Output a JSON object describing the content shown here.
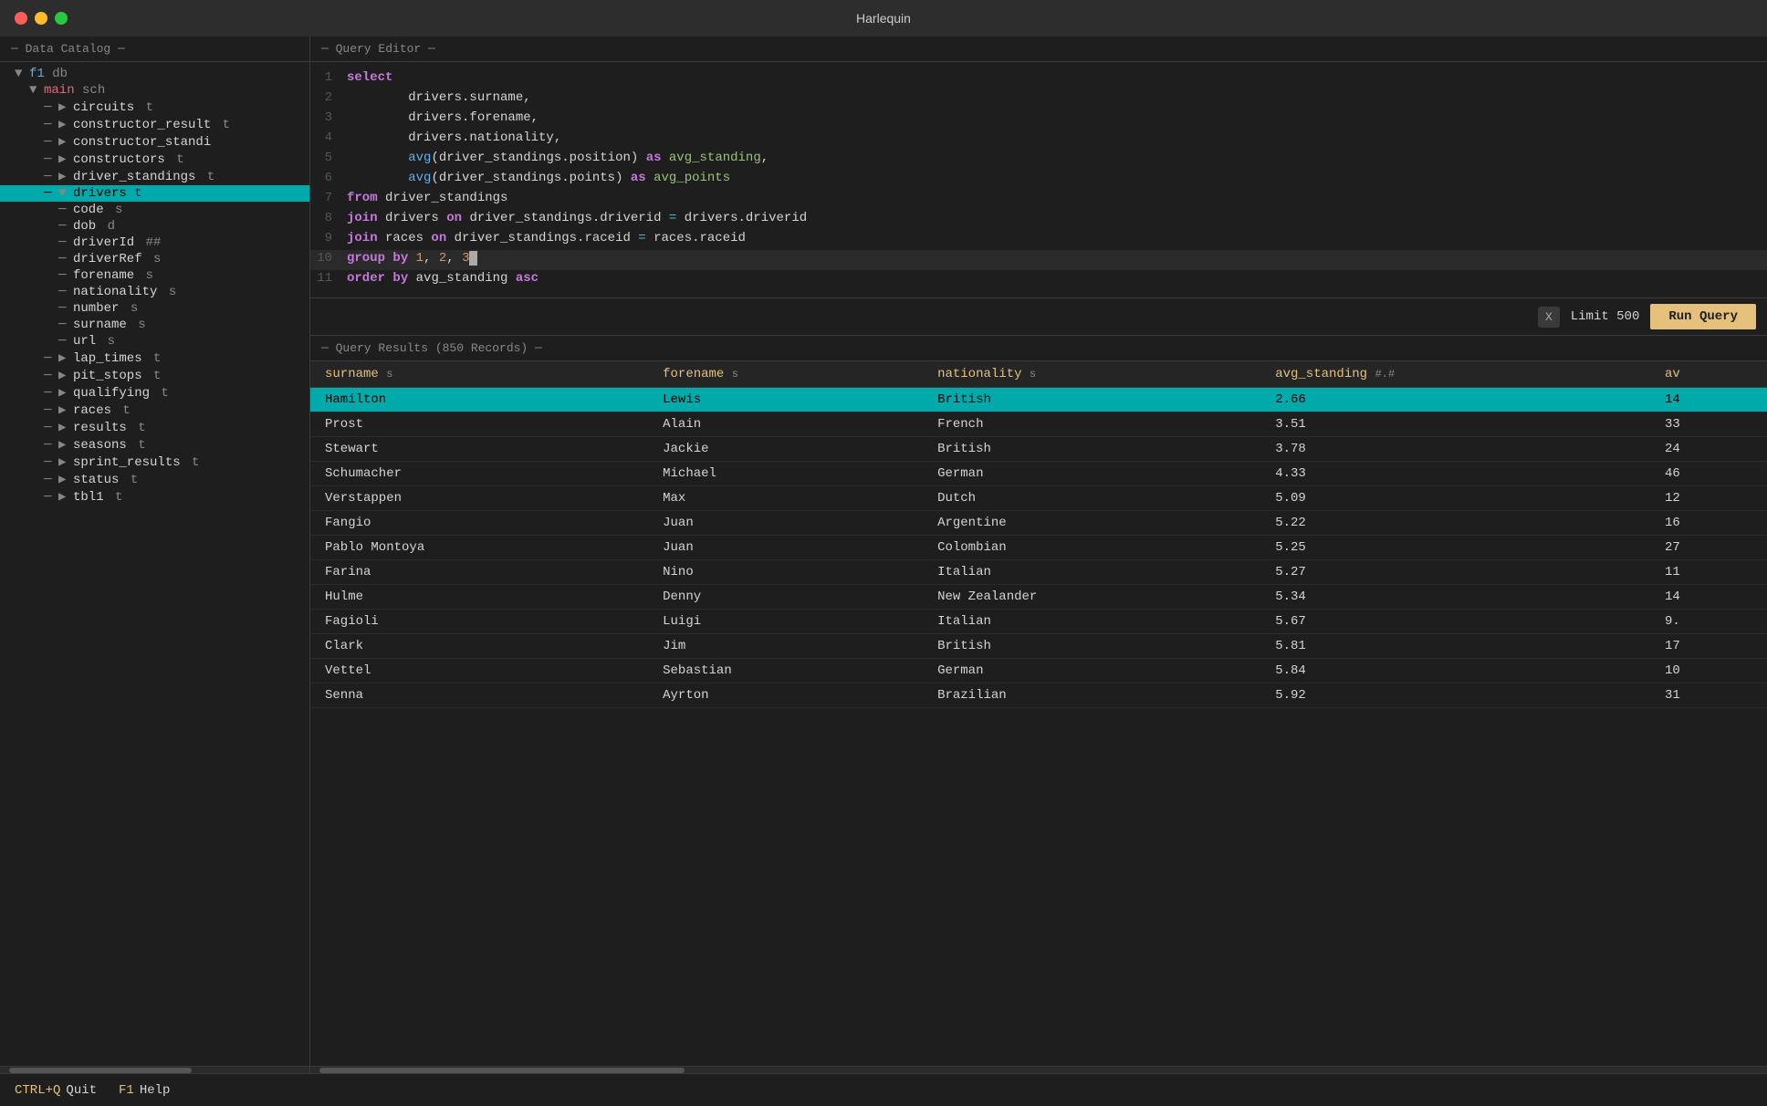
{
  "app": {
    "title": "Harlequin"
  },
  "titlebar": {
    "close": "close",
    "minimize": "minimize",
    "maximize": "maximize"
  },
  "dataCatalog": {
    "header": "─ Data Catalog ─",
    "tree": [
      {
        "label": "f1 db",
        "level": 0,
        "type": "db",
        "arrow": "▼",
        "icon": ""
      },
      {
        "label": "main",
        "suffix": " sch",
        "level": 1,
        "type": "schema",
        "arrow": "▼",
        "icon": ""
      },
      {
        "label": "circuits",
        "suffix": " t",
        "level": 2,
        "type": "table",
        "arrow": "▶",
        "icon": ""
      },
      {
        "label": "constructor_result",
        "suffix": " t",
        "level": 2,
        "type": "table",
        "arrow": "▶",
        "icon": ""
      },
      {
        "label": "constructor_standi",
        "suffix": "",
        "level": 2,
        "type": "table",
        "arrow": "▶",
        "icon": ""
      },
      {
        "label": "constructors",
        "suffix": " t",
        "level": 2,
        "type": "table",
        "arrow": "▶",
        "icon": ""
      },
      {
        "label": "driver_standings",
        "suffix": " t",
        "level": 2,
        "type": "table",
        "arrow": "▶",
        "icon": ""
      },
      {
        "label": "drivers",
        "suffix": " t",
        "level": 2,
        "type": "table",
        "arrow": "▼",
        "icon": "",
        "highlighted": true
      },
      {
        "label": "code",
        "suffix": " s",
        "level": 3,
        "type": "col",
        "arrow": "",
        "icon": "─"
      },
      {
        "label": "dob",
        "suffix": " d",
        "level": 3,
        "type": "col",
        "arrow": "",
        "icon": "─"
      },
      {
        "label": "driverId",
        "suffix": " ##",
        "level": 3,
        "type": "col",
        "arrow": "",
        "icon": "─"
      },
      {
        "label": "driverRef",
        "suffix": " s",
        "level": 3,
        "type": "col",
        "arrow": "",
        "icon": "─"
      },
      {
        "label": "forename",
        "suffix": " s",
        "level": 3,
        "type": "col",
        "arrow": "",
        "icon": "─"
      },
      {
        "label": "nationality",
        "suffix": " s",
        "level": 3,
        "type": "col",
        "arrow": "",
        "icon": "─"
      },
      {
        "label": "number",
        "suffix": " s",
        "level": 3,
        "type": "col",
        "arrow": "",
        "icon": "─"
      },
      {
        "label": "surname",
        "suffix": " s",
        "level": 3,
        "type": "col",
        "arrow": "",
        "icon": "─"
      },
      {
        "label": "url",
        "suffix": " s",
        "level": 3,
        "type": "col",
        "arrow": "",
        "icon": "─"
      },
      {
        "label": "lap_times",
        "suffix": " t",
        "level": 2,
        "type": "table",
        "arrow": "▶",
        "icon": ""
      },
      {
        "label": "pit_stops",
        "suffix": " t",
        "level": 2,
        "type": "table",
        "arrow": "▶",
        "icon": ""
      },
      {
        "label": "qualifying",
        "suffix": " t",
        "level": 2,
        "type": "table",
        "arrow": "▶",
        "icon": ""
      },
      {
        "label": "races",
        "suffix": " t",
        "level": 2,
        "type": "table",
        "arrow": "▶",
        "icon": ""
      },
      {
        "label": "results",
        "suffix": " t",
        "level": 2,
        "type": "table",
        "arrow": "▶",
        "icon": ""
      },
      {
        "label": "seasons",
        "suffix": " t",
        "level": 2,
        "type": "table",
        "arrow": "▶",
        "icon": ""
      },
      {
        "label": "sprint_results",
        "suffix": " t",
        "level": 2,
        "type": "table",
        "arrow": "▶",
        "icon": ""
      },
      {
        "label": "status",
        "suffix": " t",
        "level": 2,
        "type": "table",
        "arrow": "▶",
        "icon": ""
      },
      {
        "label": "tbl1",
        "suffix": " t",
        "level": 2,
        "type": "table",
        "arrow": "▶",
        "icon": ""
      }
    ]
  },
  "queryEditor": {
    "header": "─ Query Editor ─",
    "lines": [
      {
        "num": 1,
        "content": "select",
        "type": "keyword"
      },
      {
        "num": 2,
        "content": "    drivers.surname,"
      },
      {
        "num": 3,
        "content": "    drivers.forename,"
      },
      {
        "num": 4,
        "content": "    drivers.nationality,"
      },
      {
        "num": 5,
        "content": "    avg(driver_standings.position) as avg_standing,"
      },
      {
        "num": 6,
        "content": "    avg(driver_standings.points) as avg_points"
      },
      {
        "num": 7,
        "content": "from driver_standings"
      },
      {
        "num": 8,
        "content": "join drivers on driver_standings.driverid = drivers.driverid"
      },
      {
        "num": 9,
        "content": "join races on driver_standings.raceid = races.raceid"
      },
      {
        "num": 10,
        "content": "group by 1, 2, 3",
        "cursor": true
      },
      {
        "num": 11,
        "content": "order by avg_standing asc"
      }
    ],
    "toolbar": {
      "x_label": "X",
      "limit_label": "Limit 500",
      "run_label": "Run Query"
    }
  },
  "queryResults": {
    "header": "─ Query Results (850 Records) ─",
    "columns": [
      {
        "label": "surname",
        "type": "s"
      },
      {
        "label": "forename",
        "type": "s"
      },
      {
        "label": "nationality",
        "type": "s"
      },
      {
        "label": "avg_standing",
        "type": "#.#"
      },
      {
        "label": "av",
        "type": ""
      }
    ],
    "rows": [
      {
        "surname": "Hamilton",
        "forename": "Lewis",
        "nationality": "British",
        "avg_standing": "2.66",
        "av": "14",
        "selected": true
      },
      {
        "surname": "Prost",
        "forename": "Alain",
        "nationality": "French",
        "avg_standing": "3.51",
        "av": "33",
        "selected": false
      },
      {
        "surname": "Stewart",
        "forename": "Jackie",
        "nationality": "British",
        "avg_standing": "3.78",
        "av": "24",
        "selected": false
      },
      {
        "surname": "Schumacher",
        "forename": "Michael",
        "nationality": "German",
        "avg_standing": "4.33",
        "av": "46",
        "selected": false
      },
      {
        "surname": "Verstappen",
        "forename": "Max",
        "nationality": "Dutch",
        "avg_standing": "5.09",
        "av": "12",
        "selected": false
      },
      {
        "surname": "Fangio",
        "forename": "Juan",
        "nationality": "Argentine",
        "avg_standing": "5.22",
        "av": "16",
        "selected": false
      },
      {
        "surname": "Pablo Montoya",
        "forename": "Juan",
        "nationality": "Colombian",
        "avg_standing": "5.25",
        "av": "27",
        "selected": false
      },
      {
        "surname": "Farina",
        "forename": "Nino",
        "nationality": "Italian",
        "avg_standing": "5.27",
        "av": "11",
        "selected": false
      },
      {
        "surname": "Hulme",
        "forename": "Denny",
        "nationality": "New Zealander",
        "avg_standing": "5.34",
        "av": "14",
        "selected": false
      },
      {
        "surname": "Fagioli",
        "forename": "Luigi",
        "nationality": "Italian",
        "avg_standing": "5.67",
        "av": "9.",
        "selected": false
      },
      {
        "surname": "Clark",
        "forename": "Jim",
        "nationality": "British",
        "avg_standing": "5.81",
        "av": "17",
        "selected": false
      },
      {
        "surname": "Vettel",
        "forename": "Sebastian",
        "nationality": "German",
        "avg_standing": "5.84",
        "av": "10",
        "selected": false
      },
      {
        "surname": "Senna",
        "forename": "Ayrton",
        "nationality": "Brazilian",
        "avg_standing": "5.92",
        "av": "31",
        "selected": false
      }
    ]
  },
  "bottomBar": {
    "quit_key": "CTRL+Q",
    "quit_label": "Quit",
    "f1_key": "F1",
    "f1_label": "Help"
  }
}
